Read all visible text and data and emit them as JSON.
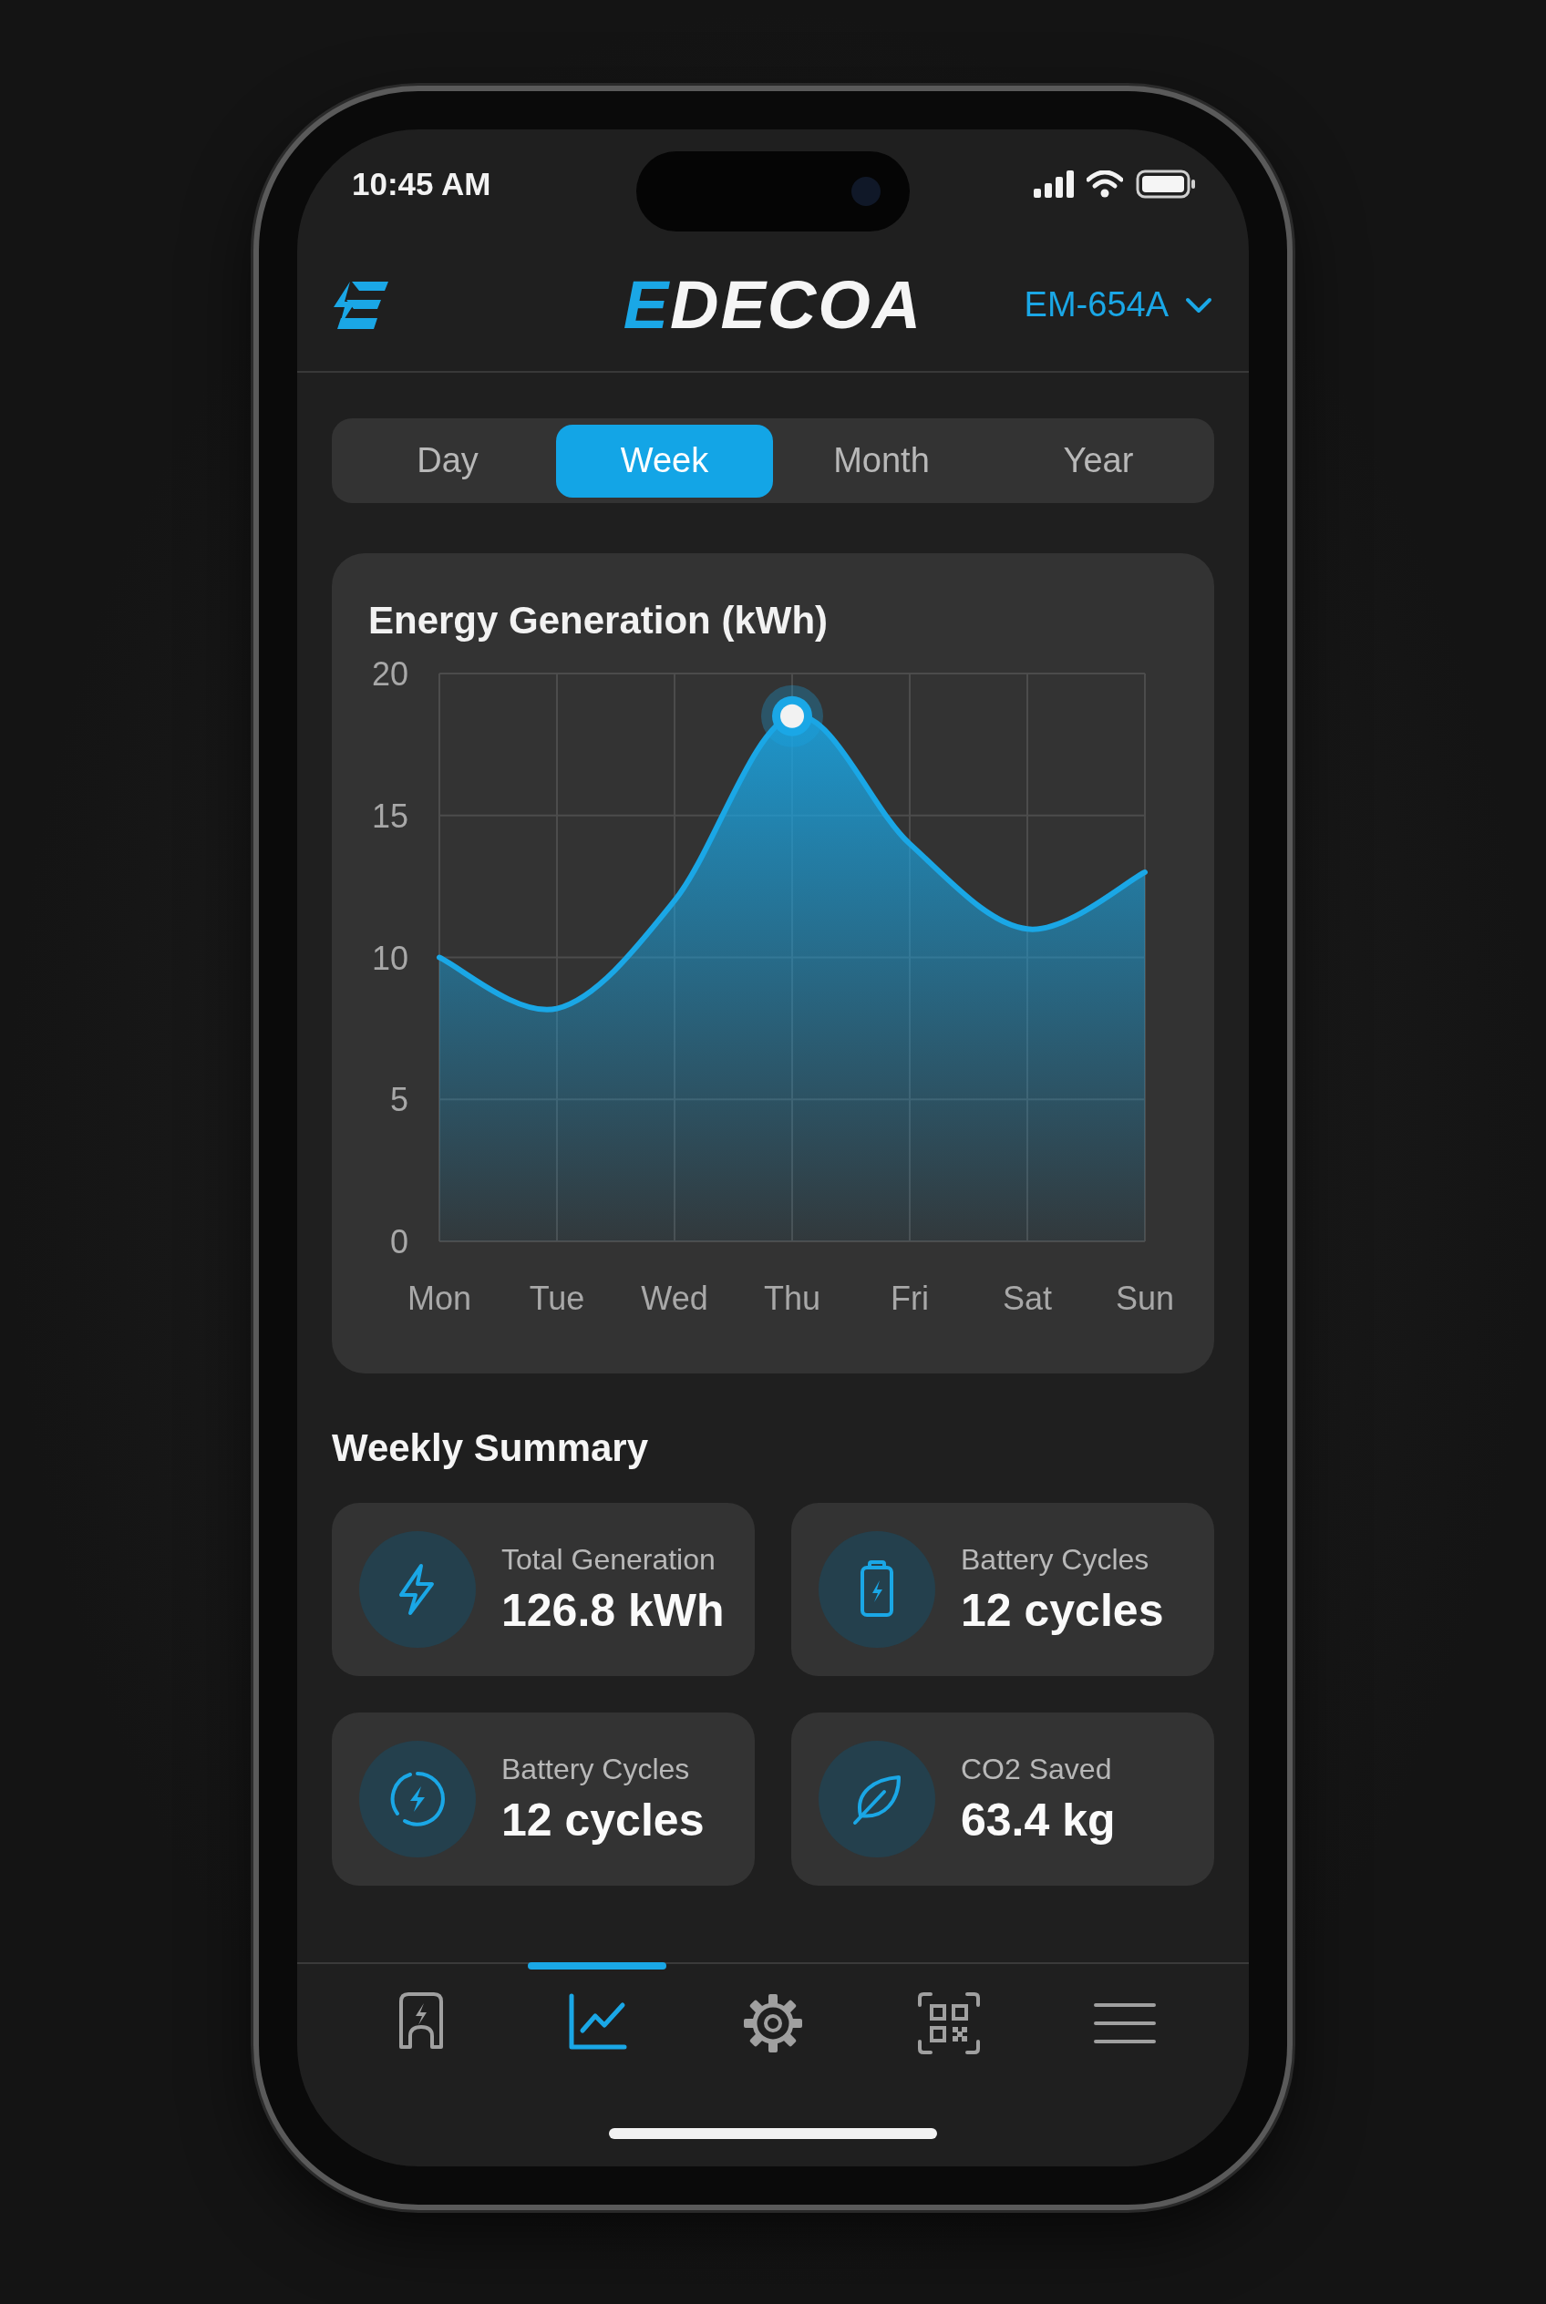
{
  "status_bar": {
    "time": "10:45 AM"
  },
  "header": {
    "brand": {
      "accent": "E",
      "rest": "DECOA"
    },
    "device": "EM-654A"
  },
  "tabs": [
    {
      "label": "Day",
      "selected": false
    },
    {
      "label": "Week",
      "selected": true
    },
    {
      "label": "Month",
      "selected": false
    },
    {
      "label": "Year",
      "selected": false
    }
  ],
  "chart_card": {
    "title": "Energy Generation (kWh)",
    "chart_data": {
      "type": "area",
      "categories": [
        "Mon",
        "Tue",
        "Wed",
        "Thu",
        "Fri",
        "Sat",
        "Sun"
      ],
      "series": [
        {
          "color": "#1aa7e6",
          "values": [
            10,
            8.2,
            12,
            18.5,
            14,
            11,
            13
          ]
        }
      ],
      "ylim": [
        0,
        20
      ],
      "yticks": [
        0,
        5,
        10,
        15,
        20
      ],
      "grid": true
    }
  },
  "summary": {
    "title": "Weekly Summary",
    "cards": [
      {
        "kind": "bolt",
        "label": "Total Generation",
        "value": "126.8 kWh"
      },
      {
        "kind": "battery",
        "label": "Battery Cycles",
        "value": "12 cycles"
      },
      {
        "kind": "cycle",
        "label": "Battery Cycles",
        "value": "12 cycles"
      },
      {
        "kind": "leaf",
        "label": "CO2 Saved",
        "value": "63.4 kg"
      }
    ]
  },
  "nav": [
    {
      "kind": "charger",
      "selected": false
    },
    {
      "kind": "chart",
      "selected": true
    },
    {
      "kind": "settings",
      "selected": false
    },
    {
      "kind": "qr",
      "selected": false
    },
    {
      "kind": "menu",
      "selected": false
    }
  ]
}
